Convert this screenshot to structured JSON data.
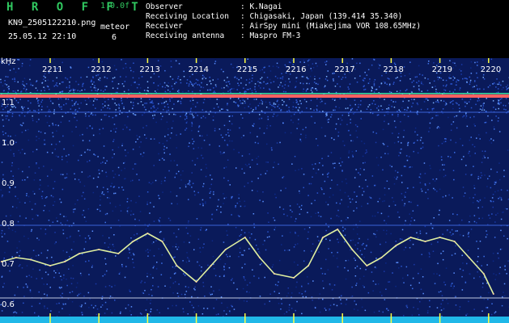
{
  "header": {
    "app_title": "H R O F F T",
    "app_version": "1.0.0f",
    "filename": "KN9_2505122210.png",
    "meteor_label": "meteor",
    "datetime": "25.05.12 22:10",
    "meteor_count": "6",
    "info": [
      {
        "key": "Observer",
        "value": ": K.Nagai"
      },
      {
        "key": "Receiving Location",
        "value": ": Chigasaki, Japan (139.414 35.340)"
      },
      {
        "key": "Receiver",
        "value": ": AirSpy mini (Miakejima VOR 108.65MHz)"
      },
      {
        "key": "Receiving antenna",
        "value": ": Maspro FM-3"
      }
    ]
  },
  "colors": {
    "background": "#000000",
    "noise_floor": "#0a1a5a",
    "carrier": "#ff6060",
    "trace": "#e0f0a0",
    "title_green": "#30c860"
  },
  "chart_data": {
    "type": "heatmap",
    "ylabel": "kHz",
    "ylim": [
      0.6,
      1.2
    ],
    "yticks": [
      "1.1",
      "1.0",
      "0.9",
      "0.8",
      "0.7",
      "0.6"
    ],
    "xticks": [
      "2211",
      "2212",
      "2213",
      "2214",
      "2215",
      "2216",
      "2217",
      "2218",
      "2219",
      "2220"
    ],
    "carrier_khz": 1.12,
    "trace": {
      "x": [
        2210.0,
        2210.3,
        2210.6,
        2211.0,
        2211.3,
        2211.6,
        2212.0,
        2212.4,
        2212.7,
        2213.0,
        2213.3,
        2213.6,
        2214.0,
        2214.3,
        2214.6,
        2215.0,
        2215.3,
        2215.6,
        2216.0,
        2216.3,
        2216.6,
        2216.9,
        2217.2,
        2217.5,
        2217.8,
        2218.1,
        2218.4,
        2218.7,
        2219.0,
        2219.3,
        2219.6,
        2219.9,
        2220.1
      ],
      "y": [
        0.71,
        0.72,
        0.715,
        0.7,
        0.71,
        0.73,
        0.74,
        0.73,
        0.76,
        0.78,
        0.76,
        0.7,
        0.66,
        0.7,
        0.74,
        0.77,
        0.72,
        0.68,
        0.67,
        0.7,
        0.77,
        0.79,
        0.74,
        0.7,
        0.72,
        0.75,
        0.77,
        0.76,
        0.77,
        0.76,
        0.72,
        0.68,
        0.63
      ]
    }
  }
}
